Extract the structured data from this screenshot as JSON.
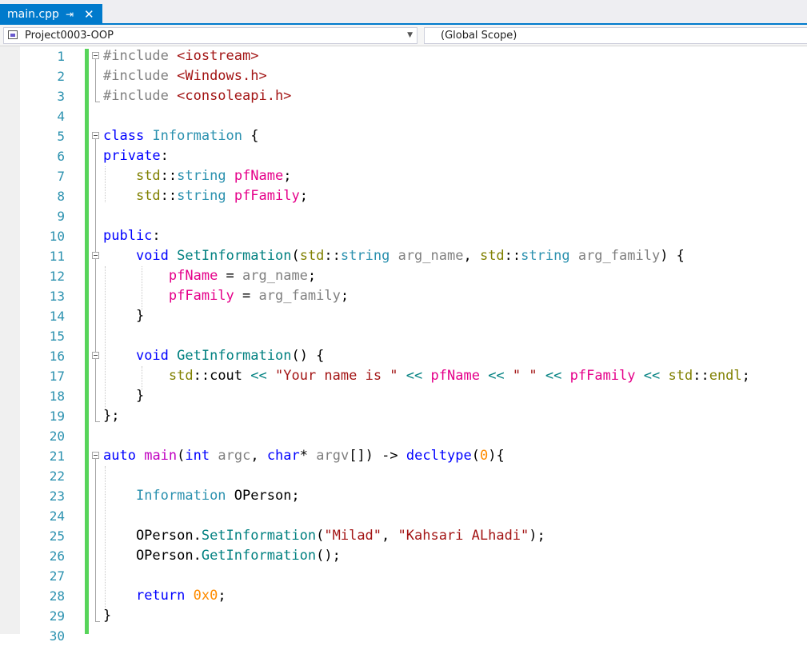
{
  "tab": {
    "title": "main.cpp",
    "pin_icon": "⇥",
    "close_icon": "✕"
  },
  "navbar": {
    "project": "Project0003-OOP",
    "project_arrow": "▼",
    "scope": "(Global Scope)"
  },
  "colors": {
    "keyword": "#0000ff",
    "preprocessor": "#808080",
    "include_path": "#a31515",
    "type": "#2b91af",
    "namespace": "#808000",
    "member": "#e5008a",
    "function": "#008080",
    "parameter": "#808080",
    "string": "#a31515",
    "number": "#ff8c00",
    "change_bar": "#57d45a",
    "accent": "#007acc"
  },
  "lines": [
    {
      "n": "1",
      "tokens": [
        {
          "c": "pp",
          "t": "#include "
        },
        {
          "c": "inc",
          "t": "<iostream>"
        }
      ]
    },
    {
      "n": "2",
      "tokens": [
        {
          "c": "pp",
          "t": "#include "
        },
        {
          "c": "inc",
          "t": "<Windows.h>"
        }
      ]
    },
    {
      "n": "3",
      "tokens": [
        {
          "c": "pp",
          "t": "#include "
        },
        {
          "c": "inc",
          "t": "<consoleapi.h>"
        }
      ]
    },
    {
      "n": "4",
      "tokens": []
    },
    {
      "n": "5",
      "tokens": [
        {
          "c": "k",
          "t": "class"
        },
        {
          "c": "",
          "t": " "
        },
        {
          "c": "t",
          "t": "Information"
        },
        {
          "c": "",
          "t": " {"
        }
      ]
    },
    {
      "n": "6",
      "tokens": [
        {
          "c": "k",
          "t": "private"
        },
        {
          "c": "",
          "t": ":"
        }
      ]
    },
    {
      "n": "7",
      "tokens": [
        {
          "c": "",
          "t": "    "
        },
        {
          "c": "tn",
          "t": "std"
        },
        {
          "c": "",
          "t": "::"
        },
        {
          "c": "t",
          "t": "string"
        },
        {
          "c": "",
          "t": " "
        },
        {
          "c": "m",
          "t": "pfName"
        },
        {
          "c": "",
          "t": ";"
        }
      ]
    },
    {
      "n": "8",
      "tokens": [
        {
          "c": "",
          "t": "    "
        },
        {
          "c": "tn",
          "t": "std"
        },
        {
          "c": "",
          "t": "::"
        },
        {
          "c": "t",
          "t": "string"
        },
        {
          "c": "",
          "t": " "
        },
        {
          "c": "m",
          "t": "pfFamily"
        },
        {
          "c": "",
          "t": ";"
        }
      ]
    },
    {
      "n": "9",
      "tokens": []
    },
    {
      "n": "10",
      "tokens": [
        {
          "c": "k",
          "t": "public"
        },
        {
          "c": "",
          "t": ":"
        }
      ]
    },
    {
      "n": "11",
      "tokens": [
        {
          "c": "",
          "t": "    "
        },
        {
          "c": "k",
          "t": "void"
        },
        {
          "c": "",
          "t": " "
        },
        {
          "c": "f",
          "t": "SetInformation"
        },
        {
          "c": "",
          "t": "("
        },
        {
          "c": "tn",
          "t": "std"
        },
        {
          "c": "",
          "t": "::"
        },
        {
          "c": "t",
          "t": "string"
        },
        {
          "c": "",
          "t": " "
        },
        {
          "c": "p",
          "t": "arg_name"
        },
        {
          "c": "",
          "t": ", "
        },
        {
          "c": "tn",
          "t": "std"
        },
        {
          "c": "",
          "t": "::"
        },
        {
          "c": "t",
          "t": "string"
        },
        {
          "c": "",
          "t": " "
        },
        {
          "c": "p",
          "t": "arg_family"
        },
        {
          "c": "",
          "t": ") {"
        }
      ]
    },
    {
      "n": "12",
      "tokens": [
        {
          "c": "",
          "t": "        "
        },
        {
          "c": "m",
          "t": "pfName"
        },
        {
          "c": "",
          "t": " = "
        },
        {
          "c": "p",
          "t": "arg_name"
        },
        {
          "c": "",
          "t": ";"
        }
      ]
    },
    {
      "n": "13",
      "tokens": [
        {
          "c": "",
          "t": "        "
        },
        {
          "c": "m",
          "t": "pfFamily"
        },
        {
          "c": "",
          "t": " = "
        },
        {
          "c": "p",
          "t": "arg_family"
        },
        {
          "c": "",
          "t": ";"
        }
      ]
    },
    {
      "n": "14",
      "tokens": [
        {
          "c": "",
          "t": "    }"
        }
      ]
    },
    {
      "n": "15",
      "tokens": []
    },
    {
      "n": "16",
      "tokens": [
        {
          "c": "",
          "t": "    "
        },
        {
          "c": "k",
          "t": "void"
        },
        {
          "c": "",
          "t": " "
        },
        {
          "c": "f",
          "t": "GetInformation"
        },
        {
          "c": "",
          "t": "() {"
        }
      ]
    },
    {
      "n": "17",
      "tokens": [
        {
          "c": "",
          "t": "        "
        },
        {
          "c": "tn",
          "t": "std"
        },
        {
          "c": "",
          "t": "::cout "
        },
        {
          "c": "f",
          "t": "<<"
        },
        {
          "c": "",
          "t": " "
        },
        {
          "c": "s",
          "t": "\"Your name is \""
        },
        {
          "c": "",
          "t": " "
        },
        {
          "c": "f",
          "t": "<<"
        },
        {
          "c": "",
          "t": " "
        },
        {
          "c": "m",
          "t": "pfName"
        },
        {
          "c": "",
          "t": " "
        },
        {
          "c": "f",
          "t": "<<"
        },
        {
          "c": "",
          "t": " "
        },
        {
          "c": "s",
          "t": "\" \""
        },
        {
          "c": "",
          "t": " "
        },
        {
          "c": "f",
          "t": "<<"
        },
        {
          "c": "",
          "t": " "
        },
        {
          "c": "m",
          "t": "pfFamily"
        },
        {
          "c": "",
          "t": " "
        },
        {
          "c": "f",
          "t": "<<"
        },
        {
          "c": "",
          "t": " "
        },
        {
          "c": "tn",
          "t": "std"
        },
        {
          "c": "",
          "t": "::"
        },
        {
          "c": "tn",
          "t": "endl"
        },
        {
          "c": "",
          "t": ";"
        }
      ]
    },
    {
      "n": "18",
      "tokens": [
        {
          "c": "",
          "t": "    }"
        }
      ]
    },
    {
      "n": "19",
      "tokens": [
        {
          "c": "",
          "t": "};"
        }
      ]
    },
    {
      "n": "20",
      "tokens": []
    },
    {
      "n": "21",
      "tokens": [
        {
          "c": "k",
          "t": "auto"
        },
        {
          "c": "",
          "t": " "
        },
        {
          "c": "fm",
          "t": "main"
        },
        {
          "c": "",
          "t": "("
        },
        {
          "c": "k",
          "t": "int"
        },
        {
          "c": "",
          "t": " "
        },
        {
          "c": "p",
          "t": "argc"
        },
        {
          "c": "",
          "t": ", "
        },
        {
          "c": "k",
          "t": "char"
        },
        {
          "c": "",
          "t": "* "
        },
        {
          "c": "p",
          "t": "argv"
        },
        {
          "c": "",
          "t": "[]) -> "
        },
        {
          "c": "k",
          "t": "decltype"
        },
        {
          "c": "",
          "t": "("
        },
        {
          "c": "n",
          "t": "0"
        },
        {
          "c": "",
          "t": "){"
        }
      ]
    },
    {
      "n": "22",
      "tokens": []
    },
    {
      "n": "23",
      "tokens": [
        {
          "c": "",
          "t": "    "
        },
        {
          "c": "t",
          "t": "Information"
        },
        {
          "c": "",
          "t": " OPerson;"
        }
      ]
    },
    {
      "n": "24",
      "tokens": []
    },
    {
      "n": "25",
      "tokens": [
        {
          "c": "",
          "t": "    OPerson."
        },
        {
          "c": "f",
          "t": "SetInformation"
        },
        {
          "c": "",
          "t": "("
        },
        {
          "c": "s",
          "t": "\"Milad\""
        },
        {
          "c": "",
          "t": ", "
        },
        {
          "c": "s",
          "t": "\"Kahsari ALhadi\""
        },
        {
          "c": "",
          "t": ");"
        }
      ]
    },
    {
      "n": "26",
      "tokens": [
        {
          "c": "",
          "t": "    OPerson."
        },
        {
          "c": "f",
          "t": "GetInformation"
        },
        {
          "c": "",
          "t": "();"
        }
      ]
    },
    {
      "n": "27",
      "tokens": []
    },
    {
      "n": "28",
      "tokens": [
        {
          "c": "",
          "t": "    "
        },
        {
          "c": "k",
          "t": "return"
        },
        {
          "c": "",
          "t": " "
        },
        {
          "c": "n",
          "t": "0x0"
        },
        {
          "c": "",
          "t": ";"
        }
      ]
    },
    {
      "n": "29",
      "tokens": [
        {
          "c": "",
          "t": "}"
        }
      ]
    },
    {
      "n": "30",
      "tokens": []
    }
  ],
  "fold_lines": [
    "1",
    "5",
    "11",
    "16",
    "21"
  ]
}
